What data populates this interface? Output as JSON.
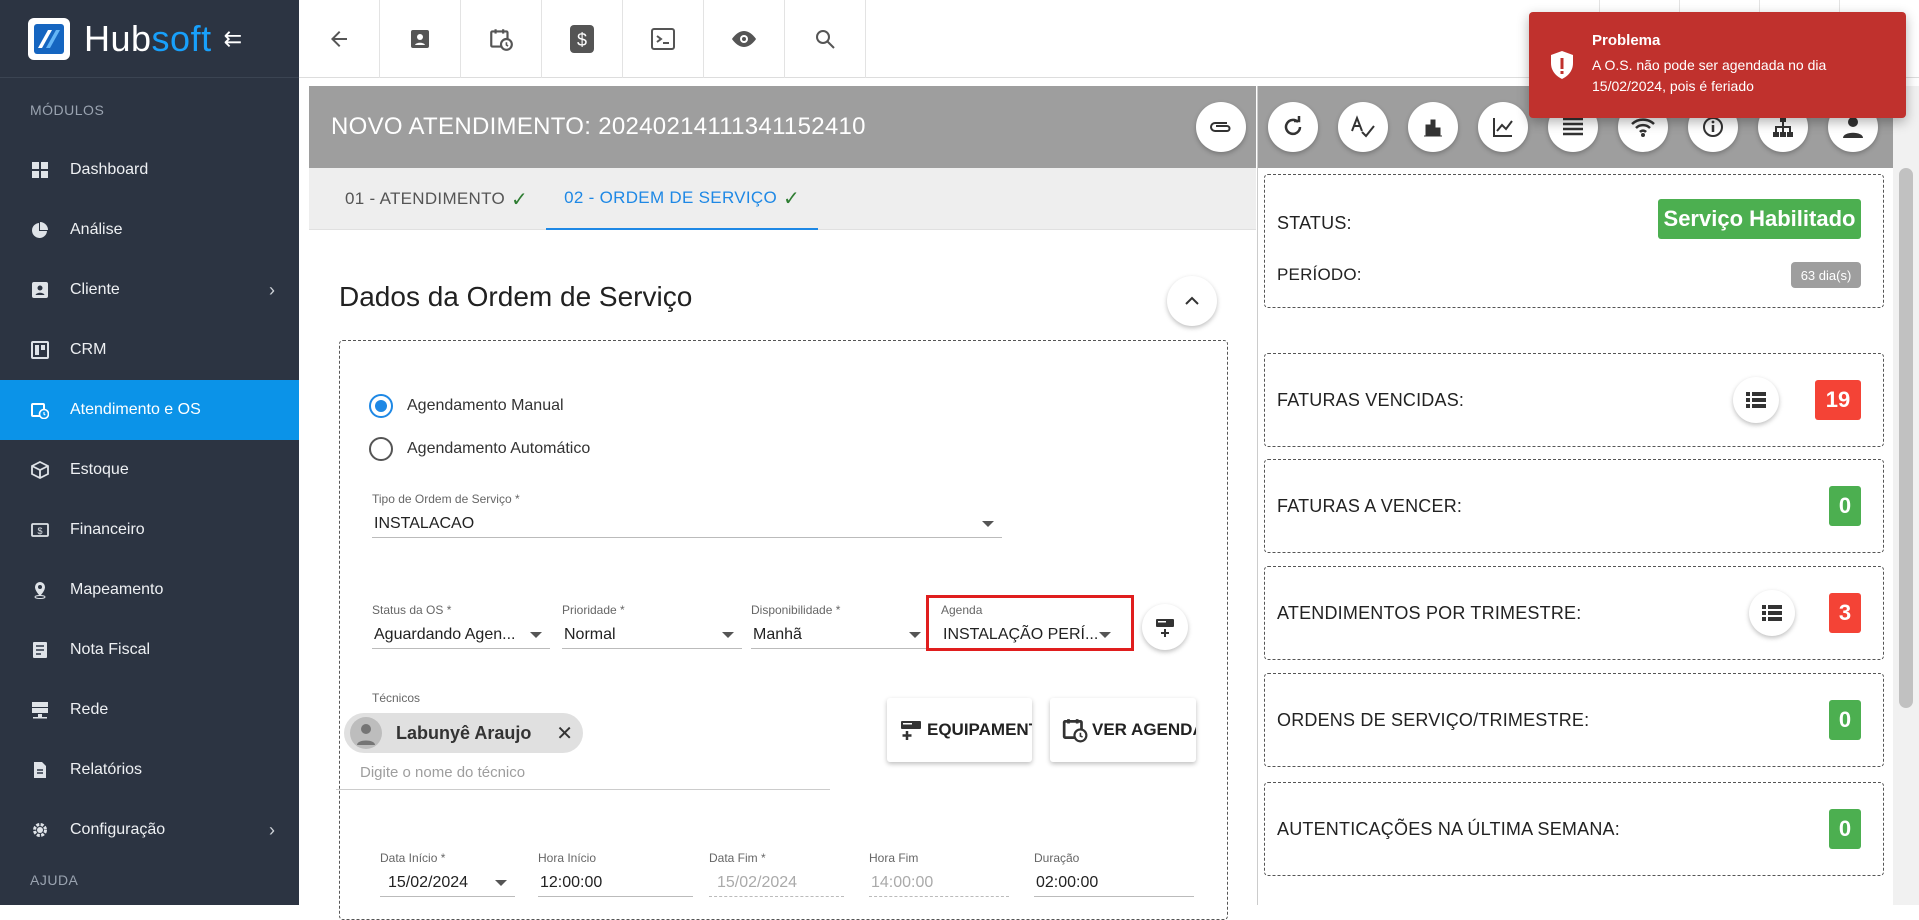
{
  "app": {
    "name_prefix": "Hub",
    "name_suffix": "soft"
  },
  "sidebar": {
    "section_modules": "MÓDULOS",
    "section_help": "AJUDA",
    "items": [
      {
        "label": "Dashboard",
        "icon": "dashboard-icon"
      },
      {
        "label": "Análise",
        "icon": "pie-chart-icon"
      },
      {
        "label": "Cliente",
        "icon": "contact-card-icon",
        "has_chevron": true
      },
      {
        "label": "CRM",
        "icon": "crm-board-icon"
      },
      {
        "label": "Atendimento e OS",
        "icon": "calendar-clock-icon",
        "active": true
      },
      {
        "label": "Estoque",
        "icon": "box-icon"
      },
      {
        "label": "Financeiro",
        "icon": "money-icon"
      },
      {
        "label": "Mapeamento",
        "icon": "map-pin-icon"
      },
      {
        "label": "Nota Fiscal",
        "icon": "invoice-icon"
      },
      {
        "label": "Rede",
        "icon": "server-icon"
      },
      {
        "label": "Relatórios",
        "icon": "report-icon"
      },
      {
        "label": "Configuração",
        "icon": "gear-icon",
        "has_chevron": true
      }
    ]
  },
  "toast": {
    "title": "Problema",
    "message_line1": "A O.S. não pode ser agendada no dia",
    "message_line2": "15/02/2024, pois é feriado",
    "color": "#c0312d"
  },
  "main": {
    "title": "NOVO ATENDIMENTO: 20240214111341152410",
    "tabs": [
      {
        "label": "01 - ATENDIMENTO",
        "active": false
      },
      {
        "label": "02 - ORDEM DE SERVIÇO",
        "active": true
      }
    ],
    "section_title": "Dados da Ordem de Serviço",
    "radio_manual": "Agendamento Manual",
    "radio_auto": "Agendamento Automático",
    "tipo_label": "Tipo de Ordem de Serviço *",
    "tipo_value": "INSTALACAO",
    "status_label": "Status da OS *",
    "status_value": "Aguardando Agen...",
    "prioridade_label": "Prioridade *",
    "prioridade_value": "Normal",
    "disponibilidade_label": "Disponibilidade *",
    "disponibilidade_value": "Manhã",
    "agenda_label": "Agenda",
    "agenda_value": "INSTALAÇÃO PERÍ...",
    "tecnicos_label": "Técnicos",
    "tecnico_name": "Labunyê Araujo",
    "tecnico_placeholder": "Digite o nome do técnico",
    "btn_equipamentos": "EQUIPAMENTOS",
    "btn_ver_agenda": "VER AGENDA",
    "data_inicio_label": "Data Início *",
    "data_inicio_value": "15/02/2024",
    "hora_inicio_label": "Hora Início",
    "hora_inicio_value": "12:00:00",
    "data_fim_label": "Data Fim *",
    "data_fim_value": "15/02/2024",
    "hora_fim_label": "Hora Fim",
    "hora_fim_value": "14:00:00",
    "duracao_label": "Duração",
    "duracao_value": "02:00:00"
  },
  "right": {
    "status_label": "STATUS:",
    "status_badge": "Serviço Habilitado",
    "periodo_label": "PERÍODO:",
    "periodo_badge": "63 dia(s)",
    "faturas_vencidas_label": "FATURAS VENCIDAS:",
    "faturas_vencidas_value": "19",
    "faturas_vencer_label": "FATURAS A VENCER:",
    "faturas_vencer_value": "0",
    "atend_trimestre_label": "ATENDIMENTOS POR TRIMESTRE:",
    "atend_trimestre_value": "3",
    "os_trimestre_label": "ORDENS DE SERVIÇO/TRIMESTRE:",
    "os_trimestre_value": "0",
    "autenticacoes_label": "AUTENTICAÇÕES NA ÚLTIMA SEMANA:",
    "autenticacoes_value": "0"
  },
  "colors": {
    "accent": "#0b93e8",
    "success": "#4caf50",
    "danger": "#f44336",
    "sidebar": "#2c3442"
  }
}
